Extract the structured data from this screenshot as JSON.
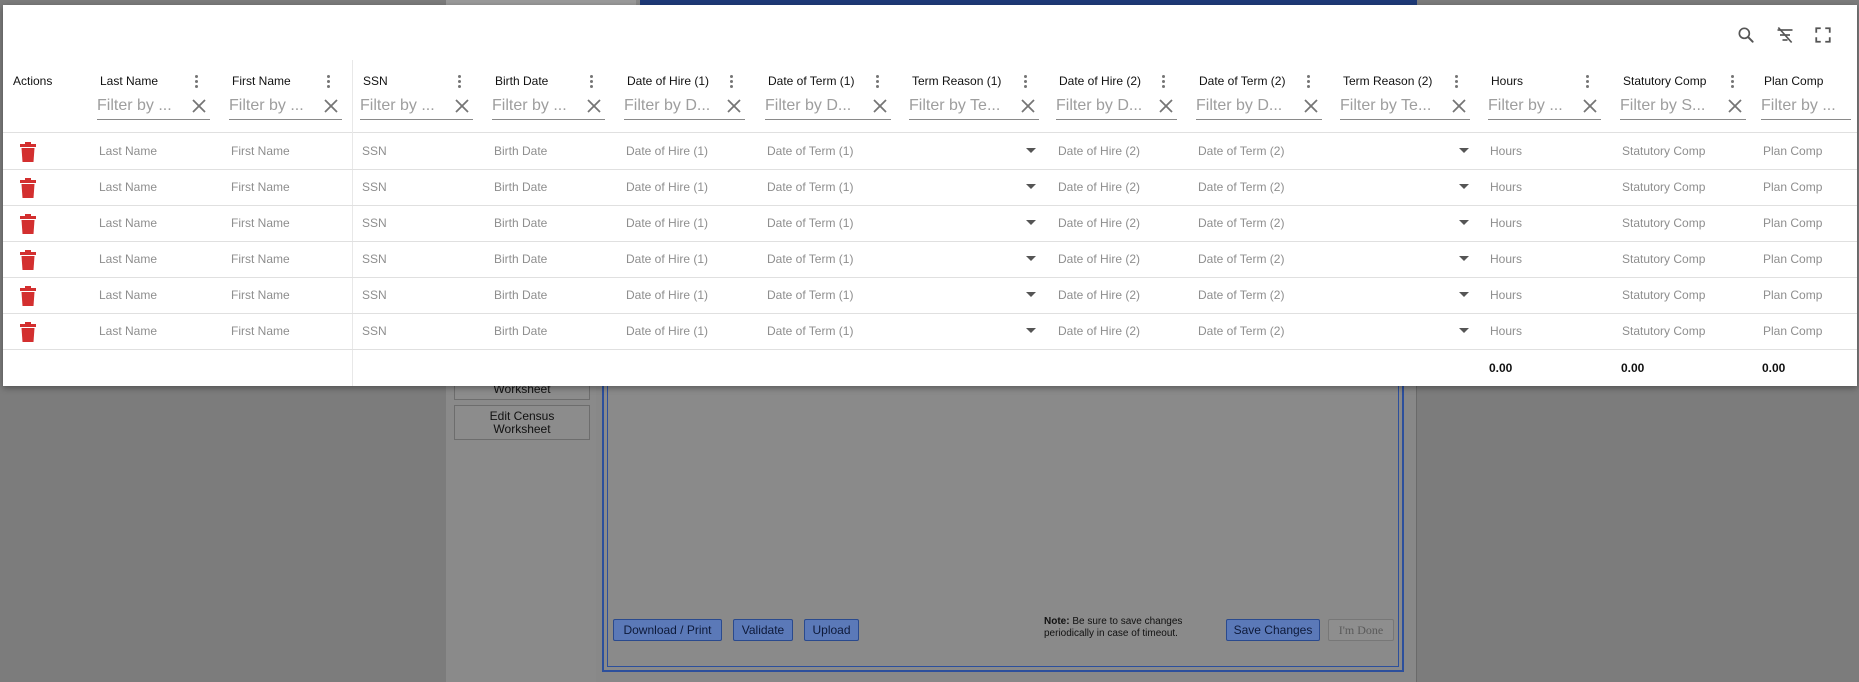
{
  "background": {
    "left_buttons": {
      "worksheet": "Worksheet",
      "edit_census": "Edit Census Worksheet"
    },
    "actions": {
      "download_print": "Download / Print",
      "validate": "Validate",
      "upload": "Upload",
      "save_changes": "Save Changes",
      "im_done": "I'm Done"
    },
    "note": {
      "label": "Note:",
      "text": " Be sure to save changes periodically in case of timeout."
    }
  },
  "grid": {
    "toolbar": {
      "icons": [
        "search-icon",
        "filter-clear-icon",
        "fullscreen-icon"
      ]
    },
    "columns": [
      {
        "key": "actions",
        "title": "Actions"
      },
      {
        "key": "last_name",
        "title": "Last Name",
        "filter_placeholder": "Filter by ..."
      },
      {
        "key": "first_name",
        "title": "First Name",
        "filter_placeholder": "Filter by ..."
      },
      {
        "key": "ssn",
        "title": "SSN",
        "filter_placeholder": "Filter by ..."
      },
      {
        "key": "birth_date",
        "title": "Birth Date",
        "filter_placeholder": "Filter by ..."
      },
      {
        "key": "date_of_hire_1",
        "title": "Date of Hire (1)",
        "filter_placeholder": "Filter by D..."
      },
      {
        "key": "date_of_term_1",
        "title": "Date of Term (1)",
        "filter_placeholder": "Filter by D..."
      },
      {
        "key": "term_reason_1",
        "title": "Term Reason (1)",
        "filter_placeholder": "Filter by Te..."
      },
      {
        "key": "date_of_hire_2",
        "title": "Date of Hire (2)",
        "filter_placeholder": "Filter by D..."
      },
      {
        "key": "date_of_term_2",
        "title": "Date of Term (2)",
        "filter_placeholder": "Filter by D..."
      },
      {
        "key": "term_reason_2",
        "title": "Term Reason (2)",
        "filter_placeholder": "Filter by Te..."
      },
      {
        "key": "hours",
        "title": "Hours",
        "filter_placeholder": "Filter by ..."
      },
      {
        "key": "statutory_comp",
        "title": "Statutory Comp",
        "filter_placeholder": "Filter by S..."
      },
      {
        "key": "plan_comp",
        "title": "Plan Comp",
        "filter_placeholder": "Filter by ..."
      }
    ],
    "rows": [
      {
        "last_name": "Last Name",
        "first_name": "First Name",
        "ssn": "SSN",
        "birth_date": "Birth Date",
        "date_of_hire_1": "Date of Hire (1)",
        "date_of_term_1": "Date of Term (1)",
        "date_of_hire_2": "Date of Hire (2)",
        "date_of_term_2": "Date of Term (2)",
        "hours": "Hours",
        "statutory_comp": "Statutory Comp",
        "plan_comp": "Plan Comp"
      },
      {
        "last_name": "Last Name",
        "first_name": "First Name",
        "ssn": "SSN",
        "birth_date": "Birth Date",
        "date_of_hire_1": "Date of Hire (1)",
        "date_of_term_1": "Date of Term (1)",
        "date_of_hire_2": "Date of Hire (2)",
        "date_of_term_2": "Date of Term (2)",
        "hours": "Hours",
        "statutory_comp": "Statutory Comp",
        "plan_comp": "Plan Comp"
      },
      {
        "last_name": "Last Name",
        "first_name": "First Name",
        "ssn": "SSN",
        "birth_date": "Birth Date",
        "date_of_hire_1": "Date of Hire (1)",
        "date_of_term_1": "Date of Term (1)",
        "date_of_hire_2": "Date of Hire (2)",
        "date_of_term_2": "Date of Term (2)",
        "hours": "Hours",
        "statutory_comp": "Statutory Comp",
        "plan_comp": "Plan Comp"
      },
      {
        "last_name": "Last Name",
        "first_name": "First Name",
        "ssn": "SSN",
        "birth_date": "Birth Date",
        "date_of_hire_1": "Date of Hire (1)",
        "date_of_term_1": "Date of Term (1)",
        "date_of_hire_2": "Date of Hire (2)",
        "date_of_term_2": "Date of Term (2)",
        "hours": "Hours",
        "statutory_comp": "Statutory Comp",
        "plan_comp": "Plan Comp"
      },
      {
        "last_name": "Last Name",
        "first_name": "First Name",
        "ssn": "SSN",
        "birth_date": "Birth Date",
        "date_of_hire_1": "Date of Hire (1)",
        "date_of_term_1": "Date of Term (1)",
        "date_of_hire_2": "Date of Hire (2)",
        "date_of_term_2": "Date of Term (2)",
        "hours": "Hours",
        "statutory_comp": "Statutory Comp",
        "plan_comp": "Plan Comp"
      },
      {
        "last_name": "Last Name",
        "first_name": "First Name",
        "ssn": "SSN",
        "birth_date": "Birth Date",
        "date_of_hire_1": "Date of Hire (1)",
        "date_of_term_1": "Date of Term (1)",
        "date_of_hire_2": "Date of Hire (2)",
        "date_of_term_2": "Date of Term (2)",
        "hours": "Hours",
        "statutory_comp": "Statutory Comp",
        "plan_comp": "Plan Comp"
      }
    ],
    "totals": {
      "hours": "0.00",
      "statutory_comp": "0.00",
      "plan_comp": "0.00"
    },
    "colors": {
      "delete_icon": "#d32f2f",
      "accent_bg": "#1e3a78"
    }
  }
}
